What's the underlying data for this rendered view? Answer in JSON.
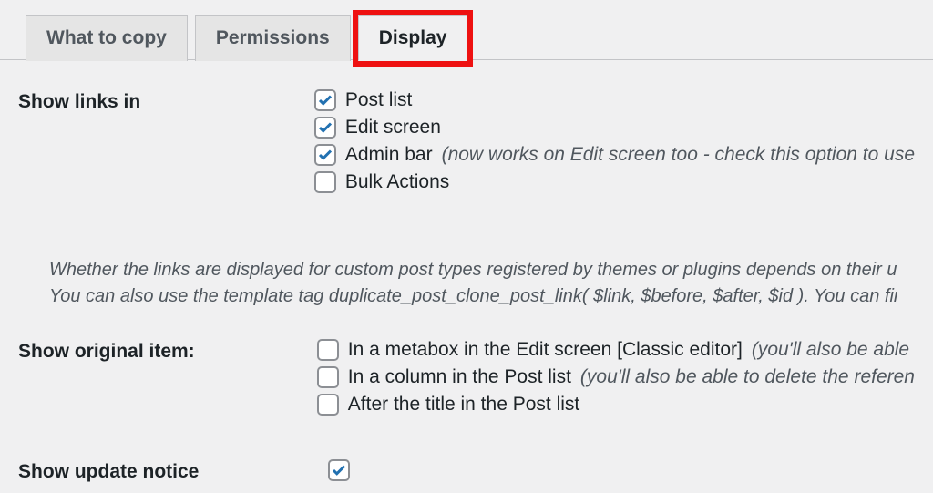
{
  "tabs": {
    "what_to_copy": "What to copy",
    "permissions": "Permissions",
    "display": "Display"
  },
  "rows": {
    "show_links": {
      "label": "Show links in",
      "options": {
        "post_list": {
          "label": "Post list",
          "checked": true
        },
        "edit_screen": {
          "label": "Edit screen",
          "checked": true
        },
        "admin_bar": {
          "label": "Admin bar",
          "checked": true,
          "hint": "(now works on Edit screen too - check this option to use "
        },
        "bulk_actions": {
          "label": "Bulk Actions",
          "checked": false
        }
      }
    },
    "desc": {
      "line1": "Whether the links are displayed for custom post types registered by themes or plugins depends on their us",
      "line2": "You can also use the template tag duplicate_post_clone_post_link( $link, $before, $after, $id ). You can find"
    },
    "show_original": {
      "label": "Show original item:",
      "options": {
        "metabox": {
          "label": "In a metabox in the Edit screen [Classic editor]",
          "hint": "(you'll also be able",
          "checked": false
        },
        "column": {
          "label": "In a column in the Post list",
          "hint": "(you'll also be able to delete the referen",
          "checked": false
        },
        "after_title": {
          "label": "After the title in the Post list",
          "checked": false
        }
      }
    },
    "show_update_notice": {
      "label": "Show update notice",
      "checked": true
    }
  }
}
